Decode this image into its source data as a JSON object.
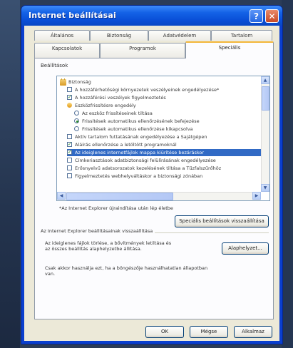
{
  "window": {
    "title": "Internet beállításai"
  },
  "tabs_back": [
    "Általános",
    "Biztonság",
    "Adatvédelem",
    "Tartalom"
  ],
  "tabs_front": [
    "Kapcsolatok",
    "Programok",
    "Speciális"
  ],
  "settings": {
    "group_label": "Beállítások",
    "items": [
      {
        "kind": "category",
        "label": "Biztonság"
      },
      {
        "kind": "check",
        "on": false,
        "label": "A hozzáférhetőségi környezetek veszélyeinek engedélyezése*"
      },
      {
        "kind": "check",
        "on": true,
        "label": "A hozzáférési veszélyek figyelmeztetés"
      },
      {
        "kind": "sub",
        "label": "Eszközfrissítésre engedély"
      },
      {
        "kind": "radio",
        "on": false,
        "label": "Az eszköz frissítéseinek tiltása"
      },
      {
        "kind": "radio",
        "on": true,
        "label": "Frissítések automatikus ellenőrzésének befejezése"
      },
      {
        "kind": "radio",
        "on": false,
        "label": "Frissítések automatikus ellenőrzése kikapcsolva"
      },
      {
        "kind": "check",
        "on": false,
        "label": "Aktív tartalom futtatásának engedélyezése a Sajátgépen"
      },
      {
        "kind": "check",
        "on": true,
        "label": "Aláírás ellenőrzése a letöltött programoknál"
      },
      {
        "kind": "check",
        "on": true,
        "label": "Az ideiglenes internetfájlok mappa kiürítése bezáráskor",
        "selected": true
      },
      {
        "kind": "check",
        "on": false,
        "label": "Címkeriasztások adatbiztonsági felülírásának engedélyezése"
      },
      {
        "kind": "check",
        "on": false,
        "label": "Erősnyelvű adatsorozatok kezelésének tiltása a Tűzfalszűrőhöz"
      },
      {
        "kind": "check",
        "on": false,
        "label": "Figyelmeztetés webhelyváltáskor a biztonsági zónában"
      }
    ]
  },
  "restart_note": "*Az Internet Explorer újraindítása után lép életbe",
  "restore_button": "Speciális beállítások visszaállítása",
  "reset": {
    "heading": "Az Internet Explorer beállításainak visszaállítása",
    "description": "Az ideiglenes fájlok törlése, a bővítmények letiltása és az összes beállítás alaphelyzetbe állítása.",
    "button": "Alaphelyzet...",
    "warning": "Csak akkor használja ezt, ha a böngészője használhatatlan állapotban van."
  },
  "footer": {
    "ok": "OK",
    "cancel": "Mégse",
    "apply": "Alkalmaz"
  },
  "colors": {
    "titlebar": "#1462e6",
    "selection": "#316ac5",
    "face": "#ece9d8"
  }
}
